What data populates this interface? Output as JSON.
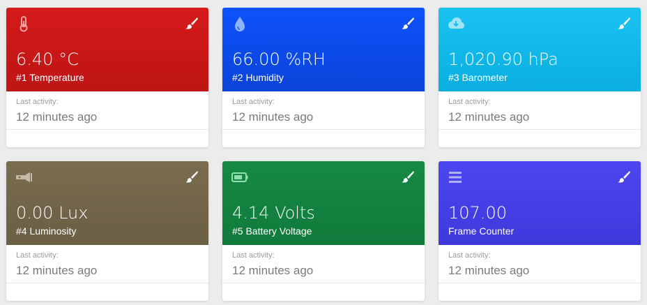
{
  "cards": [
    {
      "value": "6.40 °C",
      "name": "#1 Temperature",
      "icon": "thermometer-icon",
      "color": "#cc1818",
      "last_activity_label": "Last activity:",
      "last_activity": "12 minutes ago"
    },
    {
      "value": "66.00 %RH",
      "name": "#2 Humidity",
      "icon": "water-drop-icon",
      "color": "#0d4cf0",
      "last_activity_label": "Last activity:",
      "last_activity": "12 minutes ago"
    },
    {
      "value": "1,020.90 hPa",
      "name": "#3 Barometer",
      "icon": "cloud-download-icon",
      "color": "#12b8ea",
      "last_activity_label": "Last activity:",
      "last_activity": "12 minutes ago"
    },
    {
      "value": "0.00 Lux",
      "name": "#4 Luminosity",
      "icon": "flashlight-icon",
      "color": "#736649",
      "last_activity_label": "Last activity:",
      "last_activity": "12 minutes ago"
    },
    {
      "value": "4.14 Volts",
      "name": "#5 Battery Voltage",
      "icon": "battery-icon",
      "color": "#138240",
      "last_activity_label": "Last activity:",
      "last_activity": "12 minutes ago"
    },
    {
      "value": "107.00",
      "name": "Frame Counter",
      "icon": "menu-lines-icon",
      "color": "#4640e6",
      "last_activity_label": "Last activity:",
      "last_activity": "12 minutes ago"
    }
  ]
}
